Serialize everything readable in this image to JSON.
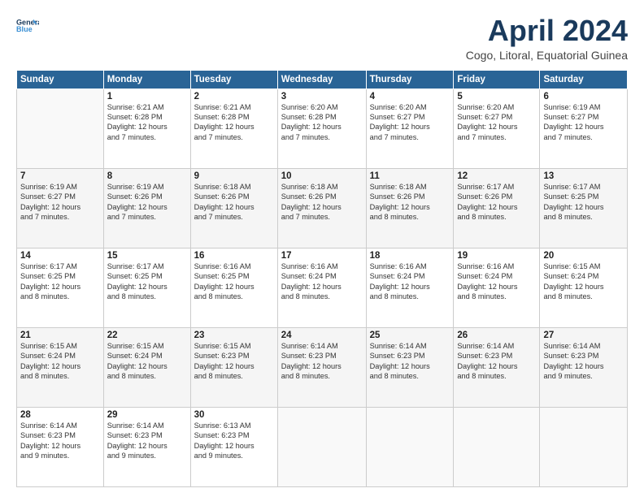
{
  "header": {
    "title": "April 2024",
    "subtitle": "Cogo, Litoral, Equatorial Guinea"
  },
  "calendar": {
    "headers": [
      "Sunday",
      "Monday",
      "Tuesday",
      "Wednesday",
      "Thursday",
      "Friday",
      "Saturday"
    ],
    "weeks": [
      [
        {
          "day": "",
          "info": ""
        },
        {
          "day": "1",
          "info": "Sunrise: 6:21 AM\nSunset: 6:28 PM\nDaylight: 12 hours\nand 7 minutes."
        },
        {
          "day": "2",
          "info": "Sunrise: 6:21 AM\nSunset: 6:28 PM\nDaylight: 12 hours\nand 7 minutes."
        },
        {
          "day": "3",
          "info": "Sunrise: 6:20 AM\nSunset: 6:28 PM\nDaylight: 12 hours\nand 7 minutes."
        },
        {
          "day": "4",
          "info": "Sunrise: 6:20 AM\nSunset: 6:27 PM\nDaylight: 12 hours\nand 7 minutes."
        },
        {
          "day": "5",
          "info": "Sunrise: 6:20 AM\nSunset: 6:27 PM\nDaylight: 12 hours\nand 7 minutes."
        },
        {
          "day": "6",
          "info": "Sunrise: 6:19 AM\nSunset: 6:27 PM\nDaylight: 12 hours\nand 7 minutes."
        }
      ],
      [
        {
          "day": "7",
          "info": "Sunrise: 6:19 AM\nSunset: 6:27 PM\nDaylight: 12 hours\nand 7 minutes."
        },
        {
          "day": "8",
          "info": "Sunrise: 6:19 AM\nSunset: 6:26 PM\nDaylight: 12 hours\nand 7 minutes."
        },
        {
          "day": "9",
          "info": "Sunrise: 6:18 AM\nSunset: 6:26 PM\nDaylight: 12 hours\nand 7 minutes."
        },
        {
          "day": "10",
          "info": "Sunrise: 6:18 AM\nSunset: 6:26 PM\nDaylight: 12 hours\nand 7 minutes."
        },
        {
          "day": "11",
          "info": "Sunrise: 6:18 AM\nSunset: 6:26 PM\nDaylight: 12 hours\nand 8 minutes."
        },
        {
          "day": "12",
          "info": "Sunrise: 6:17 AM\nSunset: 6:26 PM\nDaylight: 12 hours\nand 8 minutes."
        },
        {
          "day": "13",
          "info": "Sunrise: 6:17 AM\nSunset: 6:25 PM\nDaylight: 12 hours\nand 8 minutes."
        }
      ],
      [
        {
          "day": "14",
          "info": "Sunrise: 6:17 AM\nSunset: 6:25 PM\nDaylight: 12 hours\nand 8 minutes."
        },
        {
          "day": "15",
          "info": "Sunrise: 6:17 AM\nSunset: 6:25 PM\nDaylight: 12 hours\nand 8 minutes."
        },
        {
          "day": "16",
          "info": "Sunrise: 6:16 AM\nSunset: 6:25 PM\nDaylight: 12 hours\nand 8 minutes."
        },
        {
          "day": "17",
          "info": "Sunrise: 6:16 AM\nSunset: 6:24 PM\nDaylight: 12 hours\nand 8 minutes."
        },
        {
          "day": "18",
          "info": "Sunrise: 6:16 AM\nSunset: 6:24 PM\nDaylight: 12 hours\nand 8 minutes."
        },
        {
          "day": "19",
          "info": "Sunrise: 6:16 AM\nSunset: 6:24 PM\nDaylight: 12 hours\nand 8 minutes."
        },
        {
          "day": "20",
          "info": "Sunrise: 6:15 AM\nSunset: 6:24 PM\nDaylight: 12 hours\nand 8 minutes."
        }
      ],
      [
        {
          "day": "21",
          "info": "Sunrise: 6:15 AM\nSunset: 6:24 PM\nDaylight: 12 hours\nand 8 minutes."
        },
        {
          "day": "22",
          "info": "Sunrise: 6:15 AM\nSunset: 6:24 PM\nDaylight: 12 hours\nand 8 minutes."
        },
        {
          "day": "23",
          "info": "Sunrise: 6:15 AM\nSunset: 6:23 PM\nDaylight: 12 hours\nand 8 minutes."
        },
        {
          "day": "24",
          "info": "Sunrise: 6:14 AM\nSunset: 6:23 PM\nDaylight: 12 hours\nand 8 minutes."
        },
        {
          "day": "25",
          "info": "Sunrise: 6:14 AM\nSunset: 6:23 PM\nDaylight: 12 hours\nand 8 minutes."
        },
        {
          "day": "26",
          "info": "Sunrise: 6:14 AM\nSunset: 6:23 PM\nDaylight: 12 hours\nand 8 minutes."
        },
        {
          "day": "27",
          "info": "Sunrise: 6:14 AM\nSunset: 6:23 PM\nDaylight: 12 hours\nand 9 minutes."
        }
      ],
      [
        {
          "day": "28",
          "info": "Sunrise: 6:14 AM\nSunset: 6:23 PM\nDaylight: 12 hours\nand 9 minutes."
        },
        {
          "day": "29",
          "info": "Sunrise: 6:14 AM\nSunset: 6:23 PM\nDaylight: 12 hours\nand 9 minutes."
        },
        {
          "day": "30",
          "info": "Sunrise: 6:13 AM\nSunset: 6:23 PM\nDaylight: 12 hours\nand 9 minutes."
        },
        {
          "day": "",
          "info": ""
        },
        {
          "day": "",
          "info": ""
        },
        {
          "day": "",
          "info": ""
        },
        {
          "day": "",
          "info": ""
        }
      ]
    ]
  }
}
